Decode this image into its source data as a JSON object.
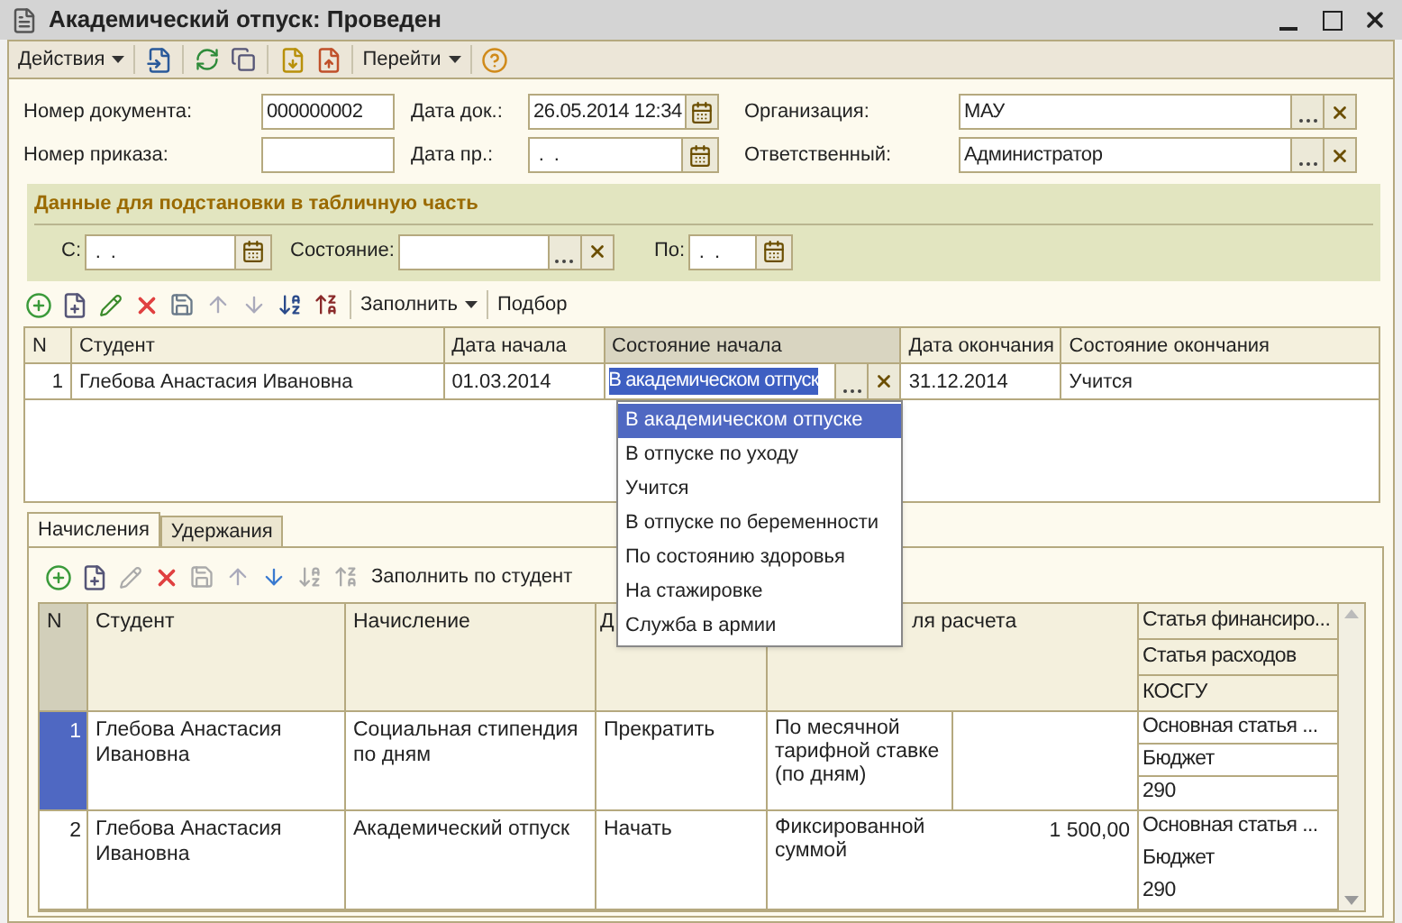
{
  "window": {
    "title": "Академический отпуск: Проведен"
  },
  "toolbar": {
    "actions": "Действия",
    "goto": "Перейти"
  },
  "header": {
    "doc_number": {
      "label": "Номер документа:",
      "value": "000000002"
    },
    "doc_date": {
      "label": "Дата док.:",
      "value": "26.05.2014 12:34"
    },
    "organization": {
      "label": "Организация:",
      "value": "МАУ"
    },
    "order_number": {
      "label": "Номер приказа:"
    },
    "order_date": {
      "label": "Дата пр.:",
      "value": " .  ."
    },
    "responsible": {
      "label": "Ответственный:",
      "value": "Администратор"
    }
  },
  "fill_group": {
    "title": "Данные для подстановки в табличную часть",
    "from": {
      "label": "С:",
      "value": " .  ."
    },
    "state": {
      "label": "Состояние:"
    },
    "to": {
      "label": "По:",
      "value": " .  ."
    }
  },
  "table_toolbar": {
    "fill": "Заполнить",
    "pick": "Подбор"
  },
  "students_table": {
    "columns": [
      {
        "label": "N",
        "selected": false
      },
      {
        "label": "Студент",
        "selected": false
      },
      {
        "label": "Дата начала",
        "selected": false
      },
      {
        "label": "Состояние начала",
        "selected": true
      },
      {
        "label": "Дата окончания",
        "selected": false
      },
      {
        "label": "Состояние окончания",
        "selected": false
      }
    ],
    "rows": [
      {
        "n": "1",
        "student": "Глебова Анастасия Ивановна",
        "start_date": "01.03.2014",
        "start_state": "В академическом отпуск",
        "end_date": "31.12.2014",
        "end_state": "Учится"
      }
    ]
  },
  "state_dropdown": [
    {
      "label": "В академическом отпуске",
      "selected": true
    },
    {
      "label": "В отпуске по уходу",
      "selected": false
    },
    {
      "label": "Учится",
      "selected": false
    },
    {
      "label": "В отпуске по беременности",
      "selected": false
    },
    {
      "label": "По состоянию здоровья",
      "selected": false
    },
    {
      "label": "На стажировке",
      "selected": false
    },
    {
      "label": "Служба в армии",
      "selected": false
    }
  ],
  "tabs": [
    {
      "label": "Начисления",
      "selected": true
    },
    {
      "label": "Удержания",
      "selected": false
    }
  ],
  "accruals_toolbar": {
    "fill": "Заполнить по студент"
  },
  "accruals_table": {
    "columns": [
      "N",
      "Студент",
      "Начисление",
      "Д",
      "ля расчета"
    ],
    "finance_columns": [
      "Статья финансиро...",
      "Статья расходов",
      "КОСГУ"
    ],
    "rows": [
      {
        "n": "1",
        "selected": true,
        "student": "Глебова Анастасия Ивановна",
        "accrual": "Социальная стипендия по дням",
        "action": "Прекратить",
        "method": "По месячной тарифной ставке (по дням)",
        "amount": "",
        "finance": [
          "Основная статья ...",
          "Бюджет",
          "290"
        ]
      },
      {
        "n": "2",
        "selected": false,
        "student": "Глебова Анастасия Ивановна",
        "accrual": "Академический отпуск",
        "action": "Начать",
        "method": "Фиксированной суммой",
        "amount": "1 500,00",
        "finance": [
          "Основная статья ...",
          "Бюджет",
          "290"
        ]
      }
    ]
  }
}
